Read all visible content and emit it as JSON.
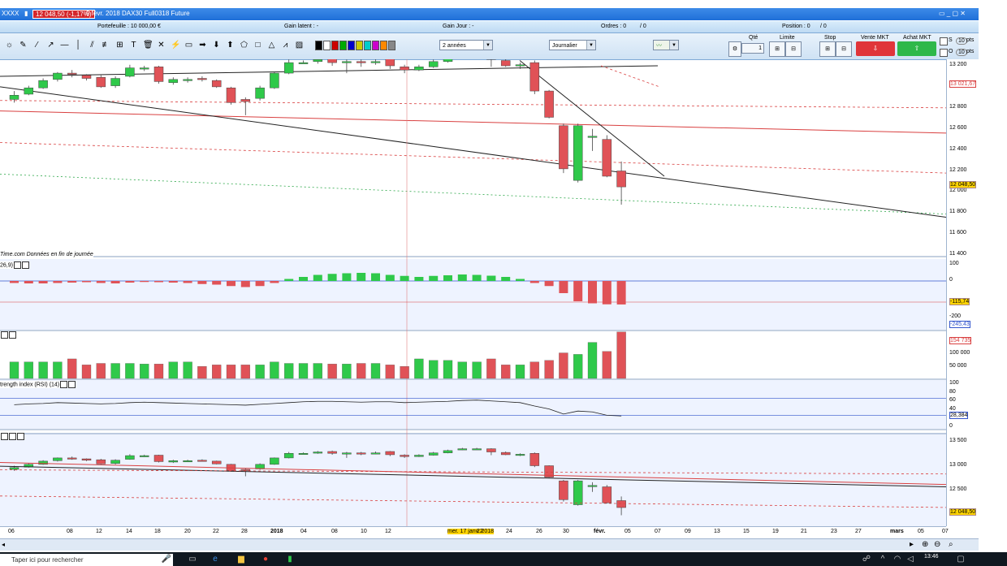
{
  "window": {
    "symbol": "XXXX",
    "price_badge": "12 048,50 (-1,17%)",
    "title": "9 févr. 2018 DAX30 Full0318 Future",
    "controls": "▭ _ ▢ ✕"
  },
  "info": {
    "portefeuille": "Portefeuille : 10 000,00 €",
    "gain_latent": "Gain latent : -",
    "gain_jour": "Gain Jour : -",
    "ordres": "Ordres : 0",
    "ordres_count": "/ 0",
    "position": "Position : 0",
    "position_count": "/ 0"
  },
  "toolbar": {
    "period_value": "2 années",
    "interval_value": "Journalier",
    "qty_label": "Qté",
    "qty_value": "1",
    "limit_label": "Limite",
    "stop_label": "Stop",
    "sell_label": "Vente MKT",
    "buy_label": "Achat MKT",
    "s_label": "S",
    "o_label": "O",
    "pts_value_1": "10",
    "pts_value_2": "10",
    "pts_unit": "pts",
    "tool_icons": [
      "pointer-icon",
      "pencil-icon",
      "line-icon",
      "ray-icon",
      "hline-icon",
      "vline-icon",
      "channel-icon",
      "fib-icon",
      "gann-icon",
      "text-icon",
      "trash-icon",
      "cross-icon",
      "alert-icon",
      "rectangle-icon",
      "arrow-right-icon",
      "arrow-down-icon",
      "arrow-up-icon",
      "polygon-icon",
      "square-icon",
      "triangle-icon",
      "zigzag-icon",
      "highlight-icon"
    ]
  },
  "panels": {
    "price_label": "Time.com Données en fin de journée",
    "macd_label": "26,9)",
    "rsi_label": "trength index (RSI) (14)"
  },
  "axis": {
    "price": [
      "13 200",
      "13 000",
      "12 800",
      "12 600",
      "12 400",
      "12 200",
      "12 000",
      "11 800",
      "11 600",
      "11 400"
    ],
    "price_current": "12 048,50",
    "price_marker": "13 021,67",
    "macd": [
      "100",
      "0",
      "-200"
    ],
    "macd_val1": "-115,74",
    "macd_val2": "-245,43",
    "volume": [
      "100 000",
      "50 000"
    ],
    "volume_marker": "154 735",
    "rsi": [
      "100",
      "80",
      "60",
      "40",
      "20",
      "0"
    ],
    "rsi_value": "28,384",
    "bottom": [
      "13 500",
      "13 000",
      "12 500"
    ],
    "bottom_current": "12 048,50"
  },
  "xaxis": {
    "labels": [
      "06",
      "08",
      "12",
      "14",
      "18",
      "20",
      "22",
      "28",
      "2018",
      "04",
      "08",
      "10",
      "12",
      "mer. 17 janv. 2018",
      "22",
      "24",
      "26",
      "30",
      "févr.",
      "05",
      "07",
      "09",
      "13",
      "15",
      "19",
      "21",
      "23",
      "27",
      "mars",
      "05",
      "07"
    ]
  },
  "taskbar": {
    "search_placeholder": "Taper ici pour rechercher",
    "clock": "13:46"
  },
  "chart_data": {
    "type": "candlestick",
    "title": "DAX30 Full0318 Future",
    "interval": "Journalier",
    "period": "2 années",
    "last_price": 12048.5,
    "change_pct": -1.17,
    "ylim": [
      11400,
      13200
    ],
    "series": [
      {
        "name": "price",
        "candles": [
          {
            "o": 12880,
            "c": 12920,
            "h": 12960,
            "l": 12850
          },
          {
            "o": 12930,
            "c": 12990,
            "h": 13010,
            "l": 12920
          },
          {
            "o": 12990,
            "c": 13060,
            "h": 13080,
            "l": 12980
          },
          {
            "o": 13070,
            "c": 13130,
            "h": 13140,
            "l": 13050
          },
          {
            "o": 13130,
            "c": 13120,
            "h": 13160,
            "l": 13090
          },
          {
            "o": 13110,
            "c": 13080,
            "h": 13120,
            "l": 13060
          },
          {
            "o": 13090,
            "c": 13000,
            "h": 13110,
            "l": 12990
          },
          {
            "o": 13010,
            "c": 13080,
            "h": 13100,
            "l": 12990
          },
          {
            "o": 13100,
            "c": 13180,
            "h": 13210,
            "l": 13090
          },
          {
            "o": 13170,
            "c": 13180,
            "h": 13200,
            "l": 13150
          },
          {
            "o": 13190,
            "c": 13050,
            "h": 13200,
            "l": 13030
          },
          {
            "o": 13040,
            "c": 13070,
            "h": 13090,
            "l": 13020
          },
          {
            "o": 13060,
            "c": 13070,
            "h": 13090,
            "l": 13040
          },
          {
            "o": 13080,
            "c": 13070,
            "h": 13100,
            "l": 13050
          },
          {
            "o": 13060,
            "c": 13000,
            "h": 13070,
            "l": 12990
          },
          {
            "o": 12990,
            "c": 12850,
            "h": 13000,
            "l": 12830
          },
          {
            "o": 12880,
            "c": 12860,
            "h": 12900,
            "l": 12730
          },
          {
            "o": 12890,
            "c": 12990,
            "h": 13010,
            "l": 12870
          },
          {
            "o": 12990,
            "c": 13130,
            "h": 13140,
            "l": 12980
          },
          {
            "o": 13130,
            "c": 13230,
            "h": 13260,
            "l": 13120
          },
          {
            "o": 13230,
            "c": 13230,
            "h": 13250,
            "l": 13220
          },
          {
            "o": 13240,
            "c": 13260,
            "h": 13280,
            "l": 13220
          },
          {
            "o": 13270,
            "c": 13230,
            "h": 13290,
            "l": 13200
          },
          {
            "o": 13230,
            "c": 13240,
            "h": 13260,
            "l": 13130
          },
          {
            "o": 13240,
            "c": 13230,
            "h": 13260,
            "l": 13190
          },
          {
            "o": 13240,
            "c": 13240,
            "h": 13270,
            "l": 13210
          },
          {
            "o": 13270,
            "c": 13200,
            "h": 13280,
            "l": 13170
          },
          {
            "o": 13190,
            "c": 13160,
            "h": 13210,
            "l": 13130
          },
          {
            "o": 13160,
            "c": 13190,
            "h": 13210,
            "l": 13150
          },
          {
            "o": 13190,
            "c": 13240,
            "h": 13260,
            "l": 13180
          },
          {
            "o": 13240,
            "c": 13290,
            "h": 13310,
            "l": 13230
          },
          {
            "o": 13310,
            "c": 13330,
            "h": 13350,
            "l": 13300
          },
          {
            "o": 13330,
            "c": 13330,
            "h": 13350,
            "l": 13310
          },
          {
            "o": 13330,
            "c": 13260,
            "h": 13340,
            "l": 13190
          },
          {
            "o": 13250,
            "c": 13200,
            "h": 13270,
            "l": 13190
          },
          {
            "o": 13200,
            "c": 13210,
            "h": 13230,
            "l": 13170
          },
          {
            "o": 13230,
            "c": 12960,
            "h": 13250,
            "l": 12930
          },
          {
            "o": 12960,
            "c": 12710,
            "h": 12970,
            "l": 12700
          },
          {
            "o": 12630,
            "c": 12220,
            "h": 12650,
            "l": 12180
          },
          {
            "o": 12110,
            "c": 12630,
            "h": 12650,
            "l": 12090
          },
          {
            "o": 12520,
            "c": 12530,
            "h": 12600,
            "l": 12390
          },
          {
            "o": 12500,
            "c": 12150,
            "h": 12540,
            "l": 12140
          },
          {
            "o": 12200,
            "c": 12048.5,
            "h": 12290,
            "l": 11880
          }
        ]
      },
      {
        "name": "macd_hist",
        "values": [
          -10,
          -12,
          -12,
          -10,
          -8,
          -6,
          -10,
          -12,
          -8,
          -5,
          -6,
          -8,
          -10,
          -15,
          -18,
          -25,
          -30,
          -25,
          -10,
          10,
          20,
          30,
          35,
          38,
          40,
          38,
          30,
          25,
          20,
          25,
          28,
          32,
          30,
          26,
          20,
          10,
          -10,
          -25,
          -60,
          -100,
          -110,
          -115,
          -115.74
        ]
      },
      {
        "name": "volume",
        "values": [
          55000,
          55000,
          55000,
          55000,
          65000,
          45000,
          50000,
          50000,
          50000,
          48000,
          48000,
          55000,
          55000,
          40000,
          45000,
          45000,
          45000,
          45000,
          55000,
          50000,
          50000,
          50000,
          48000,
          48000,
          50000,
          50000,
          45000,
          40000,
          65000,
          60000,
          60000,
          55000,
          55000,
          65000,
          45000,
          45000,
          55000,
          60000,
          85000,
          80000,
          120000,
          90000,
          154735
        ]
      },
      {
        "name": "rsi",
        "values": [
          55,
          57,
          58,
          60,
          59,
          58,
          57,
          58,
          60,
          61,
          60,
          59,
          58,
          57,
          56,
          55,
          54,
          56,
          58,
          60,
          62,
          63,
          63,
          62,
          61,
          62,
          62,
          60,
          61,
          62,
          63,
          65,
          66,
          64,
          62,
          60,
          52,
          45,
          33,
          40,
          38,
          30,
          28.384
        ]
      }
    ]
  },
  "colors": {
    "up": "#2fc94a",
    "down": "#e05257",
    "title_bar": "#1f6fd8",
    "panel_bg": "#eef3ff",
    "macd_fill_down": "#f4a0a4",
    "macd_fill_up": "#7fd87f"
  }
}
